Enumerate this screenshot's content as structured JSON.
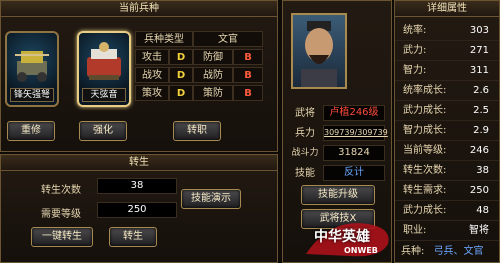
{
  "left_panel": {
    "title": "当前兵种",
    "units": [
      {
        "name": "锋矢强弩",
        "selected": false
      },
      {
        "name": "天弦音",
        "selected": true
      }
    ],
    "type_table": {
      "type_label": "兵种类型",
      "type_value": "文官",
      "rows": [
        {
          "a_label": "攻击",
          "a_grade": "D",
          "b_label": "防御",
          "b_grade": "B"
        },
        {
          "a_label": "战攻",
          "a_grade": "D",
          "b_label": "战防",
          "b_grade": "B"
        },
        {
          "a_label": "策攻",
          "a_grade": "D",
          "b_label": "策防",
          "b_grade": "B"
        }
      ]
    },
    "buttons": {
      "rebuild": "重修",
      "strengthen": "强化",
      "transfer": "转职"
    }
  },
  "rebirth": {
    "title": "转生",
    "count_label": "转生次数",
    "count_value": "38",
    "level_label": "需要等级",
    "level_value": "250",
    "skill_demo": "技能演示",
    "one_click": "一键转生",
    "rebirth_btn": "转生"
  },
  "general": {
    "name_label": "武将",
    "name_value": "卢植246级",
    "troops_label": "兵力",
    "troops_value": "309739/309739",
    "power_label": "战斗力",
    "power_value": "31824",
    "skill_label": "技能",
    "skill_value": "反计",
    "skill_upgrade": "技能升级",
    "skill_partial": "武将技X"
  },
  "details": {
    "title": "详细属性",
    "rows": [
      {
        "label": "统率:",
        "value": "303"
      },
      {
        "label": "武力:",
        "value": "271"
      },
      {
        "label": "智力:",
        "value": "311"
      },
      {
        "label": "统率成长:",
        "value": "2.6"
      },
      {
        "label": "武力成长:",
        "value": "2.5"
      },
      {
        "label": "智力成长:",
        "value": "2.9"
      },
      {
        "label": "当前等级:",
        "value": "246"
      },
      {
        "label": "转生次数:",
        "value": "38"
      },
      {
        "label": "转生需求:",
        "value": "250"
      },
      {
        "label": "武力成长:",
        "value": "48"
      },
      {
        "label": "职业:",
        "value": "智将"
      }
    ],
    "troop_label": "兵种:",
    "troop_values": "弓兵、文官"
  },
  "logo": {
    "text": "中华英雄",
    "sub": "ONWEB"
  },
  "colors": {
    "gold": "#e8cd84",
    "grade_d": "#f3d23c",
    "grade_b": "#ff5a3c",
    "red_name": "#ff4a3a",
    "link_blue": "#6aa8ff"
  }
}
